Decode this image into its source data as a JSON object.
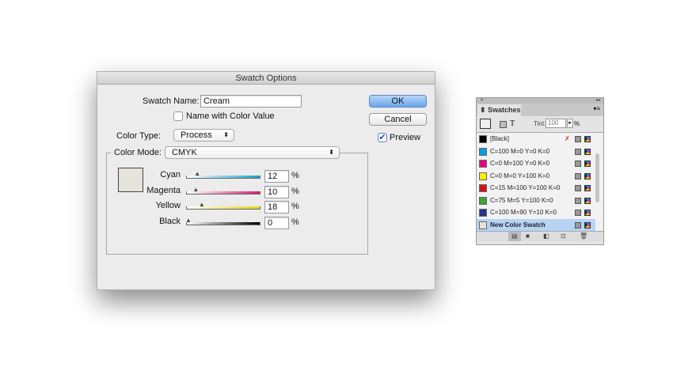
{
  "dialog": {
    "title": "Swatch Options",
    "swatch_name_label": "Swatch Name:",
    "swatch_name_value": "Cream",
    "name_with_color_value_label": "Name with Color Value",
    "name_with_color_value_checked": false,
    "color_type_label": "Color Type:",
    "color_type_value": "Process",
    "color_mode_label": "Color Mode:",
    "color_mode_value": "CMYK",
    "ok_label": "OK",
    "cancel_label": "Cancel",
    "preview_label": "Preview",
    "preview_checked": true,
    "preview_color": "#e6e3db",
    "percent": "%",
    "channels": [
      {
        "label": "Cyan",
        "value": "12",
        "color": "#1aa0d0"
      },
      {
        "label": "Magenta",
        "value": "10",
        "color": "#d0206e"
      },
      {
        "label": "Yellow",
        "value": "18",
        "color": "#e8d21a"
      },
      {
        "label": "Black",
        "value": "0",
        "color": "#000000"
      }
    ]
  },
  "panel": {
    "tab_label": "Swatches",
    "tint_label": "Tint:",
    "tint_value": "100",
    "tint_unit": "%",
    "swatches": [
      {
        "name": "[Black]",
        "color": "#000000"
      },
      {
        "name": "C=100 M=0 Y=0 K=0",
        "color": "#009fe3"
      },
      {
        "name": "C=0 M=100 Y=0 K=0",
        "color": "#e5007e"
      },
      {
        "name": "C=0 M=0 Y=100 K=0",
        "color": "#ffed00"
      },
      {
        "name": "C=15 M=100 Y=100 K=0",
        "color": "#d0141d"
      },
      {
        "name": "C=75 M=5 Y=100 K=0",
        "color": "#3aa537"
      },
      {
        "name": "C=100 M=90 Y=10 K=0",
        "color": "#27348b"
      },
      {
        "name": "New Color Swatch",
        "color": "#e6e3db"
      }
    ]
  }
}
